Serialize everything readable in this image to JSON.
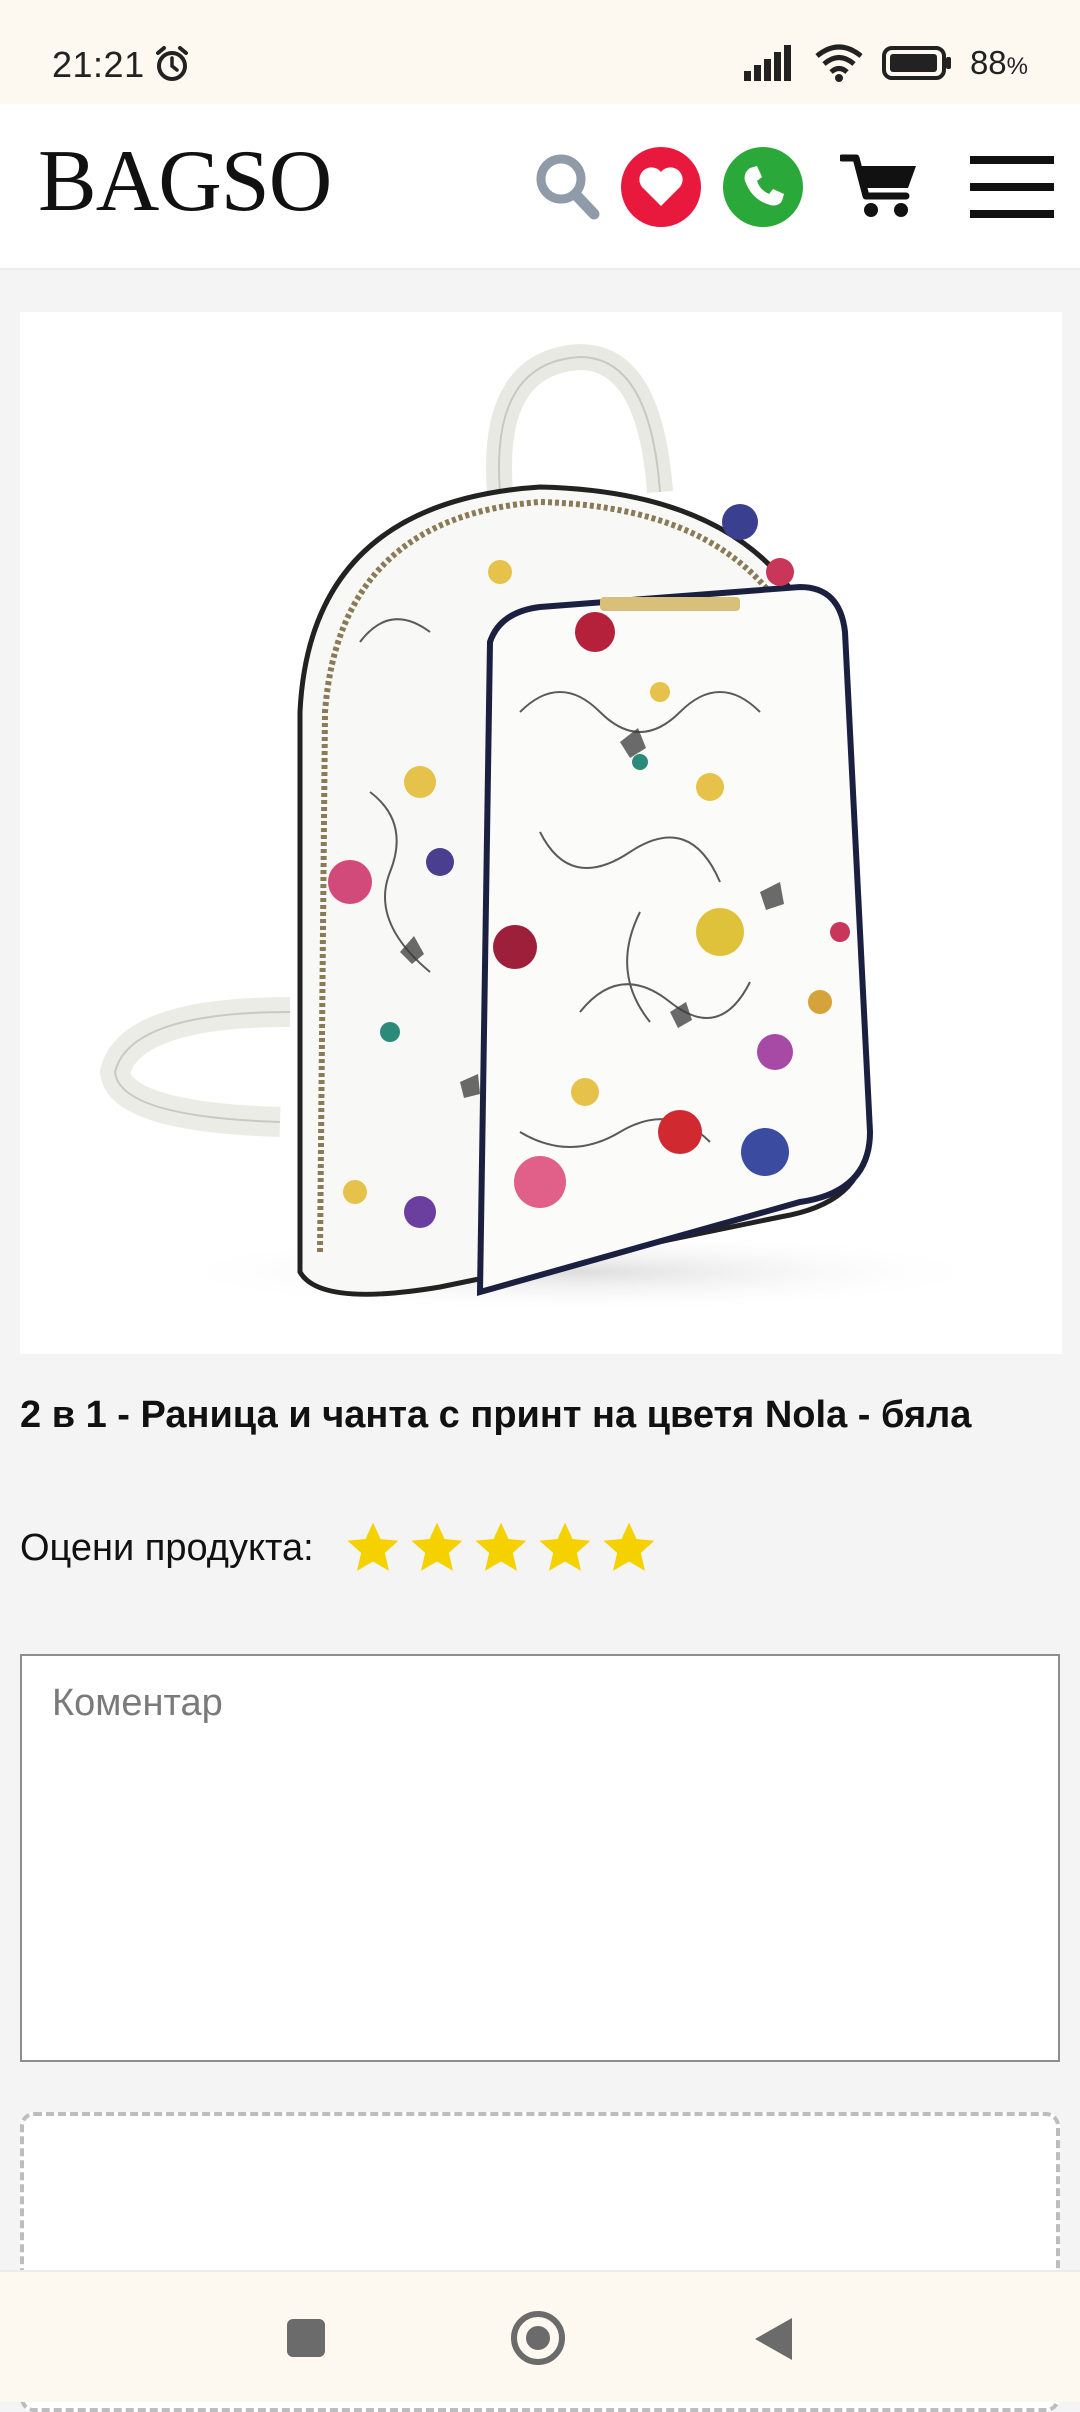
{
  "status_bar": {
    "time": "21:21",
    "battery_percent": "88",
    "battery_suffix": "%"
  },
  "header": {
    "logo": "BAGSO"
  },
  "product": {
    "title": "2 в 1 - Раница и чанта с принт на цветя Nola - бяла",
    "image_icon": "floral-backpack-image"
  },
  "rating": {
    "label": "Оцени продукта:",
    "stars_total": 5,
    "star_color": "#f5d100"
  },
  "comment": {
    "placeholder": "Коментар",
    "value": ""
  },
  "colors": {
    "favorite": "#e8193d",
    "phone": "#2aa839",
    "search": "#8f9ba8",
    "accent_bg": "#f4f4f4"
  }
}
